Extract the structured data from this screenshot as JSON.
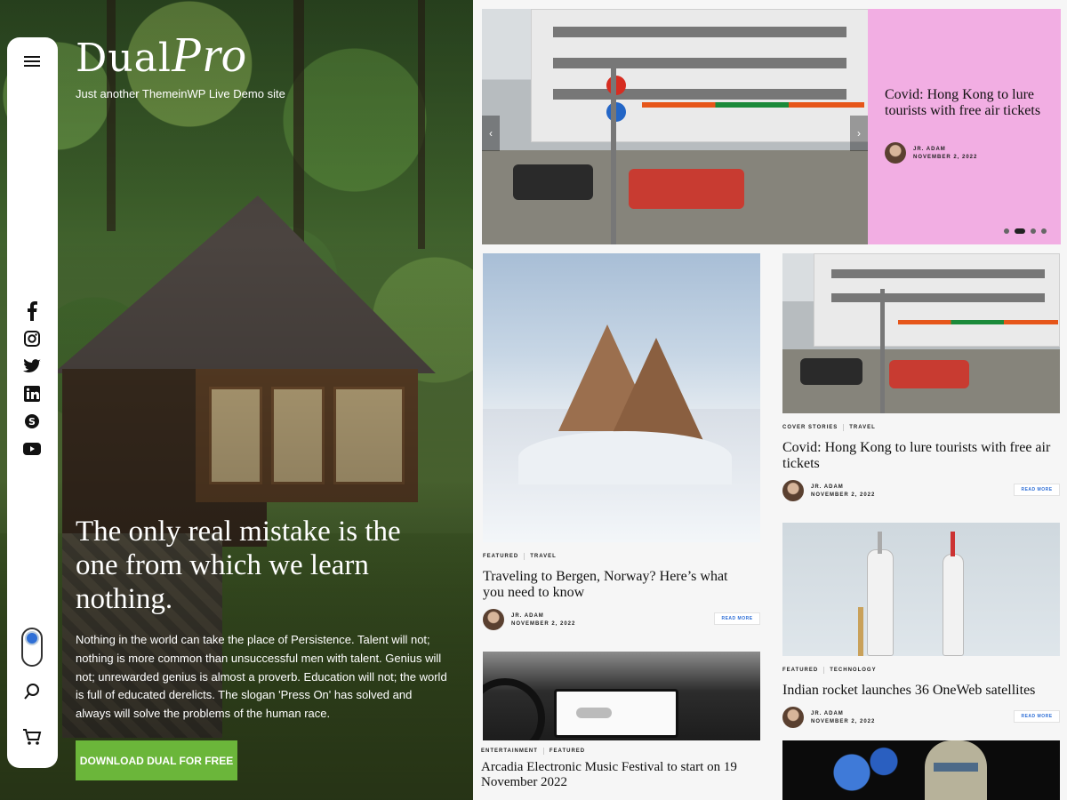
{
  "brand": {
    "logo_main": "Dual",
    "logo_pro": "Pro",
    "tagline": "Just another ThemeinWP Live Demo site"
  },
  "hero": {
    "quote": "The only real mistake is the one from which we learn nothing.",
    "description": "Nothing in the world can take the place of Persistence. Talent will not; nothing is more common than unsuccessful men with talent. Genius will not; unrewarded genius is almost a proverb. Education will not; the world is full of educated derelicts. The slogan 'Press On' has solved and always will solve the problems of the human race.",
    "cta_label": "DOWNLOAD DUAL FOR FREE"
  },
  "sidenav": {
    "menu_icon": "menu-icon",
    "social": [
      {
        "name": "facebook",
        "glyph": "f"
      },
      {
        "name": "instagram",
        "glyph": "◎"
      },
      {
        "name": "twitter",
        "glyph": "t"
      },
      {
        "name": "linkedin",
        "glyph": "in"
      },
      {
        "name": "skype",
        "glyph": "S"
      },
      {
        "name": "youtube",
        "glyph": "▶"
      }
    ],
    "toggle_icon": "dark-mode-toggle",
    "search_icon": "search-icon",
    "cart_icon": "cart-icon"
  },
  "slider": {
    "title": "Covid: Hong Kong to lure tourists with free air tickets",
    "author": "JR. ADAM",
    "date": "NOVEMBER 2, 2022",
    "prev_icon": "‹",
    "next_icon": "›",
    "panel_color": "#f2aee3"
  },
  "posts": [
    {
      "cats": [
        "FEATURED",
        "TRAVEL"
      ],
      "title": "Traveling to Bergen, Norway? Here’s what you need to know",
      "author": "JR. ADAM",
      "date": "NOVEMBER 2, 2022",
      "read_more": "READ MORE"
    },
    {
      "cats": [
        "COVER STORIES",
        "TRAVEL"
      ],
      "title": "Covid: Hong Kong to lure tourists with free air tickets",
      "author": "JR. ADAM",
      "date": "NOVEMBER 2, 2022",
      "read_more": "READ MORE"
    },
    {
      "cats": [
        "FEATURED",
        "TECHNOLOGY"
      ],
      "title": "Indian rocket launches 36 OneWeb satellites",
      "author": "JR. ADAM",
      "date": "NOVEMBER 2, 2022",
      "read_more": "READ MORE"
    },
    {
      "cats": [
        "ENTERTAINMENT",
        "FEATURED"
      ],
      "title": "Arcadia Electronic Music Festival to start on 19 November 2022"
    }
  ],
  "colors": {
    "cta_green": "#6bb63a",
    "accent_blue": "#2f6fd6",
    "slider_pink": "#f2aee3"
  }
}
